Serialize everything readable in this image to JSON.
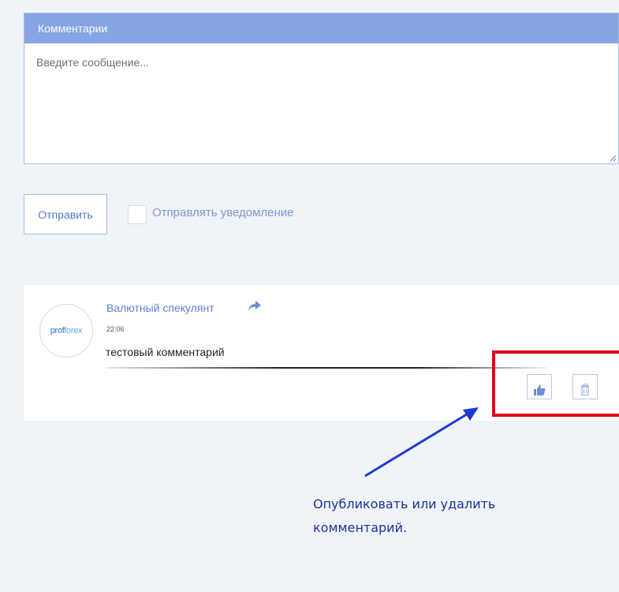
{
  "comments_section": {
    "header_title": "Комментарии",
    "message_input": {
      "placeholder": "Введите сообщение...",
      "value": ""
    }
  },
  "form_actions": {
    "send_label": "Отправить",
    "notify_label": "Отправлять уведомление",
    "notify_checked": false
  },
  "comment": {
    "author": "Валютный спекулянт",
    "avatar_logo": [
      "prof",
      "forex"
    ],
    "time": "22:06",
    "text": "тестовый комментарий",
    "icons": {
      "share": "share-arrow-icon",
      "like": "thumbs-up-icon",
      "delete": "trash-icon"
    }
  },
  "annotation": {
    "line1": "Опубликовать или удалить",
    "line2": "комментарий.",
    "color": "#1e2f9c",
    "highlight_color": "#e00018"
  },
  "colors": {
    "accent": "#86a5e4",
    "link": "#5e81c8",
    "background": "#eff4f9"
  }
}
